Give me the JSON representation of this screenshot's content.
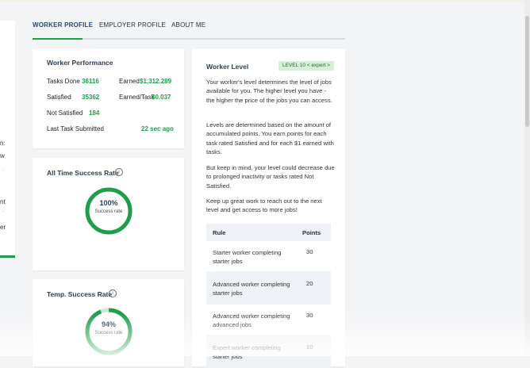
{
  "left_strip": {
    "item_a": "n:",
    "item_b": "w",
    "item_c": "nt",
    "item_d": "er"
  },
  "tabs": [
    {
      "label": "WORKER PROFILE",
      "active": true
    },
    {
      "label": "EMPLOYER PROFILE",
      "active": false
    },
    {
      "label": "ABOUT ME",
      "active": false
    }
  ],
  "performance": {
    "title": "Worker Performance",
    "tasks_done_label": "Tasks Done",
    "tasks_done_value": "36116",
    "earned_label": "Earned",
    "earned_value": "$1,312.289",
    "satisfied_label": "Satisfied",
    "satisfied_value": "35362",
    "earned_per_task_label": "Earned/Task",
    "earned_per_task_value": "$0.037",
    "not_satisfied_label": "Not Satisfied",
    "not_satisfied_value": "184",
    "last_task_label": "Last Task Submitted",
    "last_task_value": "22 sec ago"
  },
  "all_time_rate": {
    "title": "All Time Success Rate",
    "percent_text": "100%",
    "fraction": 1.0,
    "sub": "Success rate"
  },
  "temp_rate": {
    "title": "Temp. Success Rate",
    "percent_text": "94%",
    "fraction": 0.94,
    "sub": "Success rate"
  },
  "worker_level": {
    "title": "Worker Level",
    "badge": "LEVEL 10 < expert >",
    "paragraphs": [
      "Your worker's level determines the level of jobs available for you. The higher level you have - the higher the price of the jobs you can access.",
      "Levels are determined based on the amount of accumulated points. You earn points for each task rated Satisfied and for each $1 earned with tasks.",
      "But keep in mind, your level could decrease due to prolonged inactivity or tasks rated Not Satisfied.",
      "Keep up great work to reach out to the next level and get access to more jobs!"
    ],
    "rules_header": {
      "rule": "Rule",
      "points": "Points"
    },
    "rules": [
      {
        "rule": "Starter worker completing starter jobs",
        "points": "30"
      },
      {
        "rule": "Advanced worker completing starter jobs",
        "points": "20"
      },
      {
        "rule": "Advanced worker completing advanced jobs",
        "points": "30"
      },
      {
        "rule": "Expert worker completing starter jobs",
        "points": "10"
      }
    ]
  },
  "colors": {
    "accent": "#1e9e4a",
    "ring_track": "#cfe6d4",
    "tab_active": "#244a78"
  }
}
